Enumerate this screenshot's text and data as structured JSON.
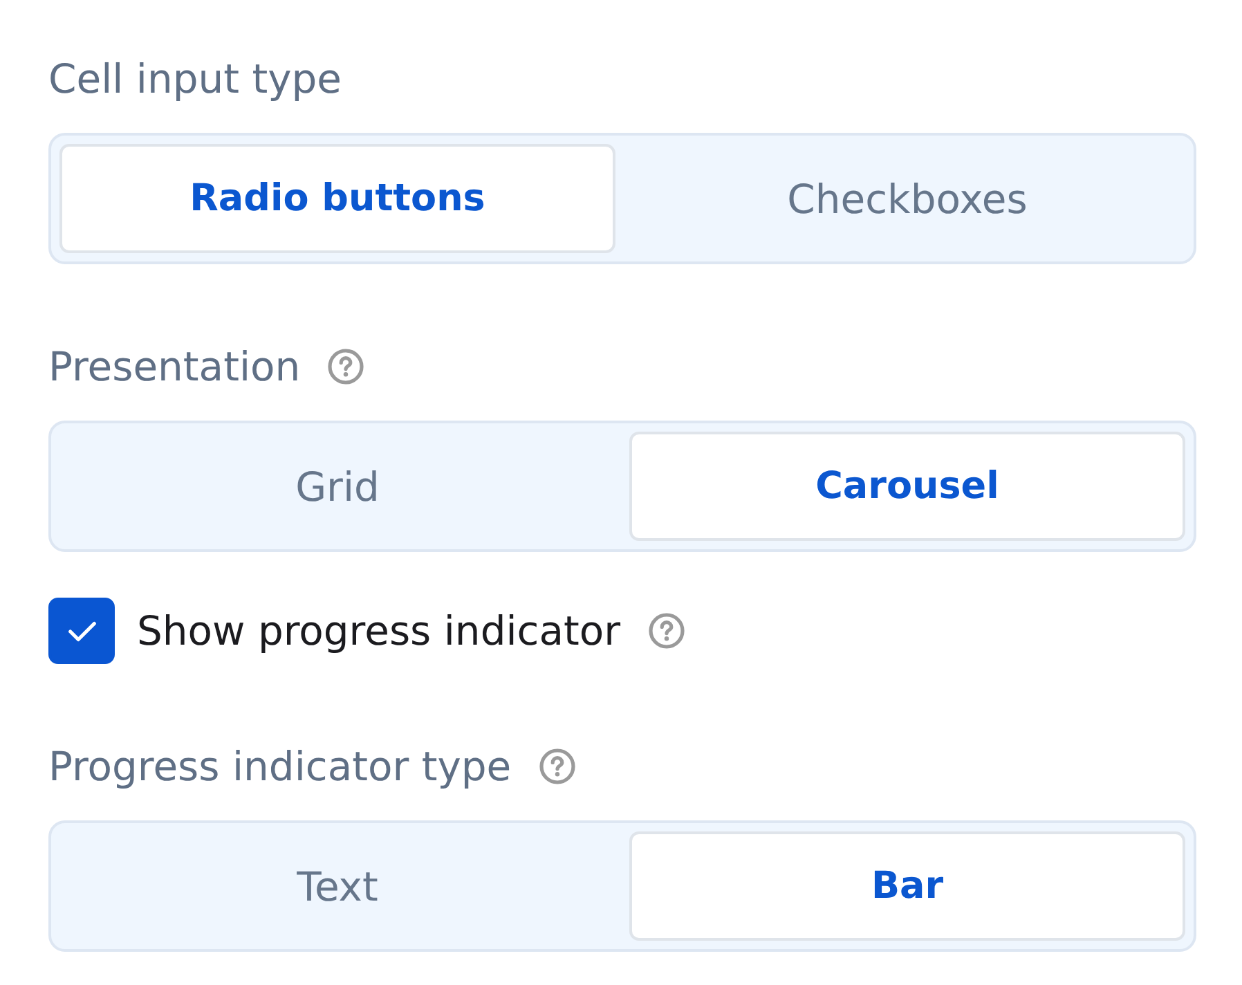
{
  "sections": [
    {
      "kind": "segmented",
      "label": "Cell input type",
      "help": false,
      "options": [
        {
          "label": "Radio buttons",
          "selected": true
        },
        {
          "label": "Checkboxes",
          "selected": false
        }
      ]
    },
    {
      "kind": "segmented",
      "label": "Presentation",
      "help": true,
      "options": [
        {
          "label": "Grid",
          "selected": false
        },
        {
          "label": "Carousel",
          "selected": true
        }
      ]
    },
    {
      "kind": "checkbox",
      "label": "Show progress indicator",
      "checked": true,
      "help": true
    },
    {
      "kind": "segmented",
      "label": "Progress indicator type",
      "help": true,
      "options": [
        {
          "label": "Text",
          "selected": false
        },
        {
          "label": "Bar",
          "selected": true
        }
      ]
    }
  ]
}
